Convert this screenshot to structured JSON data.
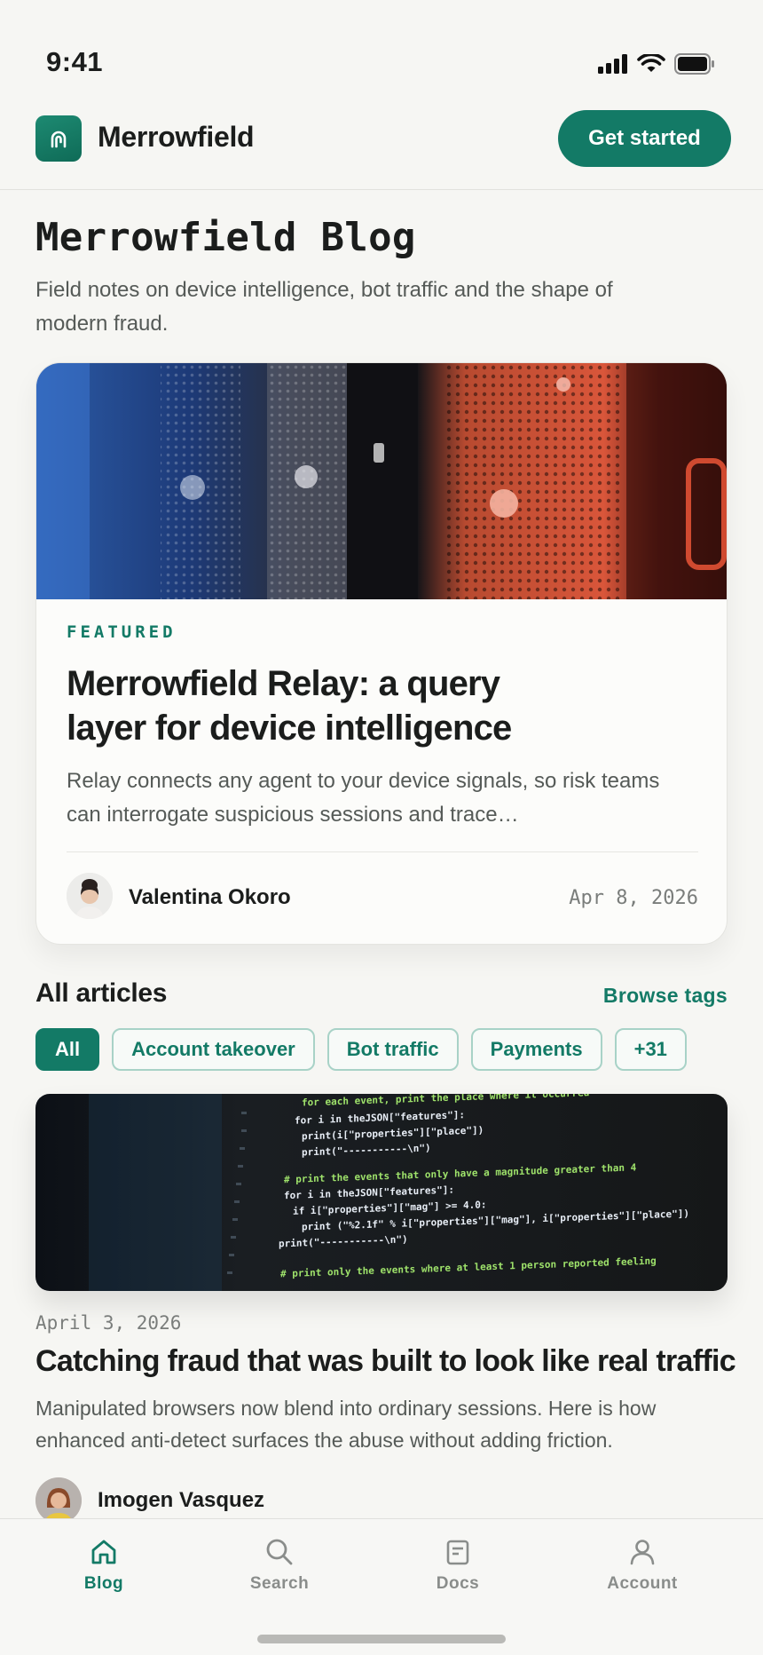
{
  "status": {
    "time": "9:41"
  },
  "header": {
    "brand": "Merrowfield",
    "cta": "Get started"
  },
  "page": {
    "title": "Merrowfield Blog",
    "subtitle": "Field notes on device intelligence, bot traffic and the shape of modern fraud."
  },
  "featured": {
    "kicker": "FEATURED",
    "title": "Merrowfield Relay: a query layer for device intelligence",
    "excerpt": "Relay connects any agent to your device signals, so risk teams can interrogate suspicious sessions and trace…",
    "author": "Valentina Okoro",
    "date": "Apr 8, 2026"
  },
  "articles_section": {
    "title": "All articles",
    "browse_label": "Browse tags",
    "chips": [
      "All",
      "Account takeover",
      "Bot traffic",
      "Payments",
      "+31"
    ]
  },
  "article": {
    "date": "April 3, 2026",
    "title": "Catching fraud that was built to look like real traffic",
    "excerpt": "Manipulated browsers now blend into ordinary sessions. Here is how enhanced anti-detect surfaces the abuse without adding friction.",
    "author": "Imogen Vasquez"
  },
  "code_image": {
    "lines": [
      "for each event, print the place where it occurred",
      "for i in theJSON[\"features\"]:",
      "print(i[\"properties\"][\"place\"])",
      "print(\"-----------\\n\")",
      "# print the events that only have a magnitude greater than 4",
      "for i in theJSON[\"features\"]:",
      "if i[\"properties\"][\"mag\"] >= 4.0:",
      "print (\"%2.1f\" % i[\"properties\"][\"mag\"], i[\"properties\"][\"place\"])",
      "print(\"-----------\\n\")",
      "# print only the events where at least 1 person reported feeling"
    ]
  },
  "tabs": [
    {
      "label": "Blog",
      "icon": "home-icon"
    },
    {
      "label": "Search",
      "icon": "search-icon"
    },
    {
      "label": "Docs",
      "icon": "document-icon"
    },
    {
      "label": "Account",
      "icon": "account-icon"
    }
  ],
  "colors": {
    "accent": "#137a66",
    "background": "#f6f6f3"
  }
}
